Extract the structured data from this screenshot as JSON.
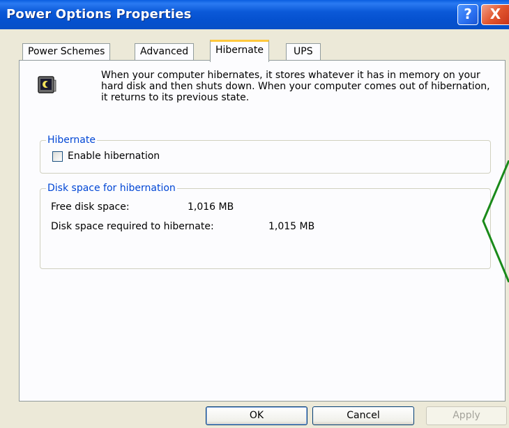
{
  "window": {
    "title": "Power Options Properties",
    "help_label": "?",
    "close_label": "X"
  },
  "tabs": [
    {
      "label": "Power Schemes"
    },
    {
      "label": "Advanced"
    },
    {
      "label": "Hibernate"
    },
    {
      "label": "UPS"
    }
  ],
  "active_tab": "Hibernate",
  "description": "When your computer hibernates, it stores whatever it has in memory on your hard disk and then shuts down. When your computer comes out of hibernation, it returns to its previous state.",
  "hibernate_group": {
    "title": "Hibernate",
    "checkbox_label": "Enable hibernation",
    "checked": false
  },
  "disk_group": {
    "title": "Disk space for hibernation",
    "free_label": "Free disk space:",
    "free_value": "1,016 MB",
    "required_label": "Disk space required to hibernate:",
    "required_value": "1,015 MB"
  },
  "buttons": {
    "ok": "OK",
    "cancel": "Cancel",
    "apply": "Apply"
  },
  "colors": {
    "titlebar": "#0b59d8",
    "group_title": "#0046d5",
    "active_tab_accent": "#ffc83c",
    "annotation": "#1a8a1a"
  },
  "icons": {
    "window_icon": "monitor-moon-icon",
    "annotation": "green-angle-bracket"
  }
}
